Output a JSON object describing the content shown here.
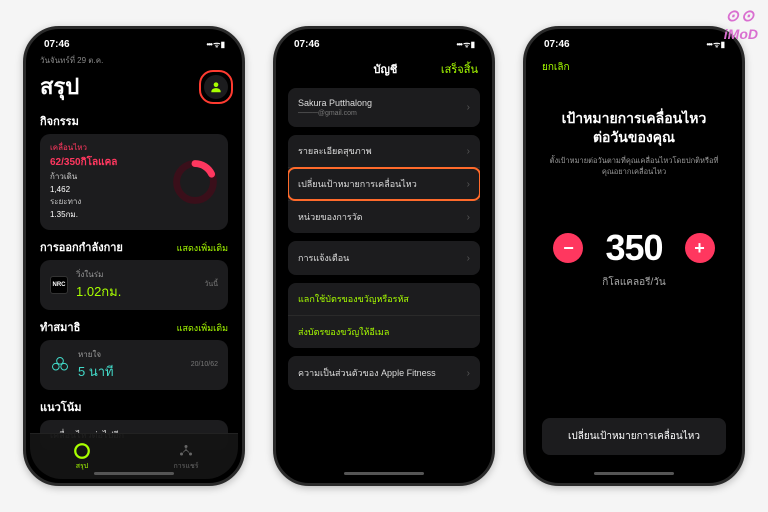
{
  "status": {
    "time": "07:46",
    "signal": "▪▪▪▪",
    "wifi": "◉",
    "battery": "▮"
  },
  "watermark": "iMoD",
  "screen1": {
    "date": "วันจันทร์ที่ 29 ต.ค.",
    "title": "สรุป",
    "activity_label": "กิจกรรม",
    "move_label": "เคลื่อนไหว",
    "move_value": "62/350กิโลแคล",
    "steps_label": "ก้าวเดิน",
    "steps_value": "1,462",
    "distance_label": "ระยะทาง",
    "distance_value": "1.35กม.",
    "workouts_label": "การออกกำลังกาย",
    "see_more": "แสดงเพิ่มเติม",
    "workout_name": "วิ่งในร่ม",
    "workout_value": "1.02กม.",
    "workout_date": "วันนี้",
    "mind_label": "ทำสมาธิ",
    "breathe_name": "หายใจ",
    "breathe_value": "5 นาที",
    "breathe_date": "20/10/62",
    "trends_label": "แนวโน้ม",
    "trend_row": "เคลื่อนไหวต่อไปอีก",
    "tab_summary": "สรุป",
    "tab_share": "การแชร์"
  },
  "screen2": {
    "nav_title": "บัญชี",
    "done": "เสร็จสิ้น",
    "profile_name": "Sakura Putthalong",
    "profile_email": "────@gmail.com",
    "rows": {
      "health": "รายละเอียดสุขภาพ",
      "change_goal": "เปลี่ยนเป้าหมายการเคลื่อนไหว",
      "units": "หน่วยของการวัด",
      "notifications": "การแจ้งเตือน",
      "redeem": "แลกใช้บัตรของขวัญหรือรหัส",
      "send_gift": "ส่งบัตรของขวัญให้อีเมล",
      "privacy": "ความเป็นส่วนตัวของ Apple Fitness"
    }
  },
  "screen3": {
    "cancel": "ยกเลิก",
    "title_l1": "เป้าหมายการเคลื่อนไหว",
    "title_l2": "ต่อวันของคุณ",
    "sub": "ตั้งเป้าหมายต่อวันตามที่คุณเคลื่อนไหวโดยปกติหรือที่คุณอยากเคลื่อนไหว",
    "value": "350",
    "unit": "กิโลแคลอรี/วัน",
    "change_btn": "เปลี่ยนเป้าหมายการเคลื่อนไหว"
  }
}
